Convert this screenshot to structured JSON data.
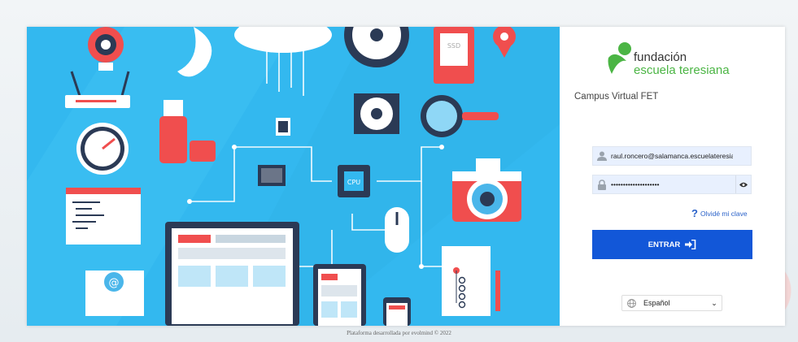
{
  "brand": {
    "line1": "fundación",
    "line2": "escuela teresiana"
  },
  "campus_title": "Campus Virtual FET",
  "login": {
    "username_value": "raul.roncero@salamanca.escuelateresiana.cc",
    "password_value": "••••••••••••••••••••",
    "forgot_label": "Olvidé mi clave",
    "submit_label": "ENTRAR"
  },
  "language": {
    "selected": "Español"
  },
  "illustration": {
    "cpu_label": "CPU",
    "ssd_label": "SSD"
  },
  "footer": "Plataforma desarrollada por evolmind © 2022",
  "colors": {
    "illustration_bg": "#33b8ef",
    "primary_button": "#1257d8",
    "brand_green": "#4bb544",
    "link": "#2a62c9"
  }
}
